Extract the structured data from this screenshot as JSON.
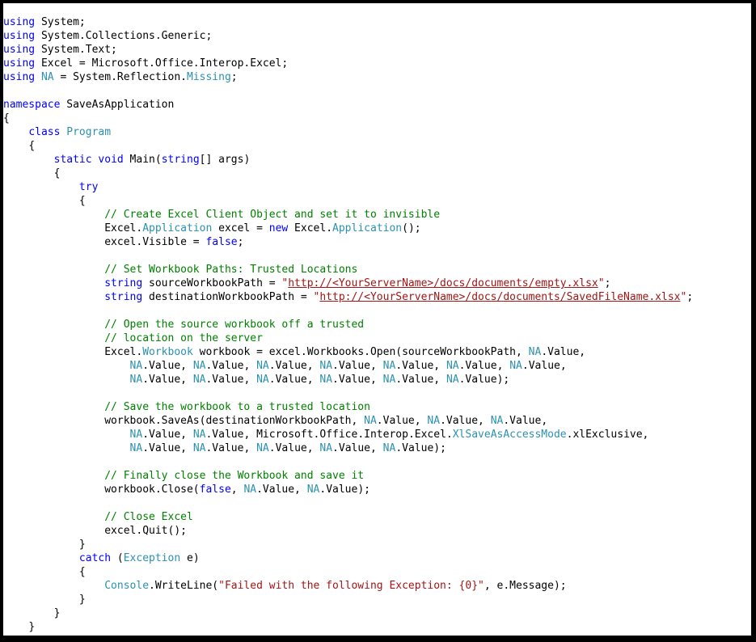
{
  "window": {
    "kind": "code-snippet-image",
    "border_color": "#000000",
    "background_color": "#ffffff",
    "language": "C#"
  },
  "theme": {
    "plain": "#000000",
    "keyword": "#0000ff",
    "type": "#2b91af",
    "comment": "#008000",
    "string": "#a31515",
    "url_string": "#a31515"
  },
  "code": {
    "indent_unit": "    ",
    "lines": [
      {
        "id": "l1",
        "indent": 0,
        "tokens": [
          {
            "t": "using",
            "c": "kw"
          },
          {
            "t": " System;",
            "c": "pl"
          }
        ]
      },
      {
        "id": "l2",
        "indent": 0,
        "tokens": [
          {
            "t": "using",
            "c": "kw"
          },
          {
            "t": " System.Collections.Generic;",
            "c": "pl"
          }
        ]
      },
      {
        "id": "l3",
        "indent": 0,
        "tokens": [
          {
            "t": "using",
            "c": "kw"
          },
          {
            "t": " System.Text;",
            "c": "pl"
          }
        ]
      },
      {
        "id": "l4",
        "indent": 0,
        "tokens": [
          {
            "t": "using",
            "c": "kw"
          },
          {
            "t": " Excel = Microsoft.Office.Interop.Excel;",
            "c": "pl"
          }
        ]
      },
      {
        "id": "l5",
        "indent": 0,
        "tokens": [
          {
            "t": "using",
            "c": "kw"
          },
          {
            "t": " ",
            "c": "pl"
          },
          {
            "t": "NA",
            "c": "ty"
          },
          {
            "t": " = System.Reflection.",
            "c": "pl"
          },
          {
            "t": "Missing",
            "c": "ty"
          },
          {
            "t": ";",
            "c": "pl"
          }
        ]
      },
      {
        "id": "l6",
        "indent": 0,
        "tokens": []
      },
      {
        "id": "l7",
        "indent": 0,
        "tokens": [
          {
            "t": "namespace",
            "c": "kw"
          },
          {
            "t": " SaveAsApplication",
            "c": "pl"
          }
        ]
      },
      {
        "id": "l8",
        "indent": 0,
        "tokens": [
          {
            "t": "{",
            "c": "pl"
          }
        ]
      },
      {
        "id": "l9",
        "indent": 1,
        "tokens": [
          {
            "t": "class",
            "c": "kw"
          },
          {
            "t": " ",
            "c": "pl"
          },
          {
            "t": "Program",
            "c": "ty"
          }
        ]
      },
      {
        "id": "l10",
        "indent": 1,
        "tokens": [
          {
            "t": "{",
            "c": "pl"
          }
        ]
      },
      {
        "id": "l11",
        "indent": 2,
        "tokens": [
          {
            "t": "static",
            "c": "kw"
          },
          {
            "t": " ",
            "c": "pl"
          },
          {
            "t": "void",
            "c": "kw"
          },
          {
            "t": " Main(",
            "c": "pl"
          },
          {
            "t": "string",
            "c": "kw"
          },
          {
            "t": "[] args)",
            "c": "pl"
          }
        ]
      },
      {
        "id": "l12",
        "indent": 2,
        "tokens": [
          {
            "t": "{",
            "c": "pl"
          }
        ]
      },
      {
        "id": "l13",
        "indent": 3,
        "tokens": [
          {
            "t": "try",
            "c": "kw"
          }
        ]
      },
      {
        "id": "l14",
        "indent": 3,
        "tokens": [
          {
            "t": "{",
            "c": "pl"
          }
        ]
      },
      {
        "id": "l15",
        "indent": 4,
        "tokens": [
          {
            "t": "// Create Excel Client Object and set it to invisible",
            "c": "cm"
          }
        ]
      },
      {
        "id": "l16",
        "indent": 4,
        "tokens": [
          {
            "t": "Excel.",
            "c": "pl"
          },
          {
            "t": "Application",
            "c": "ty"
          },
          {
            "t": " excel = ",
            "c": "pl"
          },
          {
            "t": "new",
            "c": "kw"
          },
          {
            "t": " Excel.",
            "c": "pl"
          },
          {
            "t": "Application",
            "c": "ty"
          },
          {
            "t": "();",
            "c": "pl"
          }
        ]
      },
      {
        "id": "l17",
        "indent": 4,
        "tokens": [
          {
            "t": "excel.Visible = ",
            "c": "pl"
          },
          {
            "t": "false",
            "c": "kw"
          },
          {
            "t": ";",
            "c": "pl"
          }
        ]
      },
      {
        "id": "l18",
        "indent": 0,
        "tokens": []
      },
      {
        "id": "l19",
        "indent": 4,
        "tokens": [
          {
            "t": "// Set Workbook Paths: Trusted Locations",
            "c": "cm"
          }
        ]
      },
      {
        "id": "l20",
        "indent": 4,
        "tokens": [
          {
            "t": "string",
            "c": "kw"
          },
          {
            "t": " sourceWorkbookPath = ",
            "c": "pl"
          },
          {
            "t": "\"",
            "c": "st"
          },
          {
            "t": "http://<YourServerName>/docs/documents/empty.xlsx",
            "c": "url"
          },
          {
            "t": "\"",
            "c": "st"
          },
          {
            "t": ";",
            "c": "pl"
          }
        ]
      },
      {
        "id": "l21",
        "indent": 4,
        "tokens": [
          {
            "t": "string",
            "c": "kw"
          },
          {
            "t": " destinationWorkbookPath = ",
            "c": "pl"
          },
          {
            "t": "\"",
            "c": "st"
          },
          {
            "t": "http://<YourServerName>/docs/documents/SavedFileName.xlsx",
            "c": "url"
          },
          {
            "t": "\"",
            "c": "st"
          },
          {
            "t": ";",
            "c": "pl"
          }
        ]
      },
      {
        "id": "l22",
        "indent": 0,
        "tokens": []
      },
      {
        "id": "l23",
        "indent": 4,
        "tokens": [
          {
            "t": "// Open the source workbook off a trusted",
            "c": "cm"
          }
        ]
      },
      {
        "id": "l24",
        "indent": 4,
        "tokens": [
          {
            "t": "// location on the server",
            "c": "cm"
          }
        ]
      },
      {
        "id": "l25",
        "indent": 4,
        "tokens": [
          {
            "t": "Excel.",
            "c": "pl"
          },
          {
            "t": "Workbook",
            "c": "ty"
          },
          {
            "t": " workbook = excel.Workbooks.Open(sourceWorkbookPath, ",
            "c": "pl"
          },
          {
            "t": "NA",
            "c": "ty"
          },
          {
            "t": ".Value,",
            "c": "pl"
          }
        ]
      },
      {
        "id": "l26",
        "indent": 5,
        "tokens": [
          {
            "t": "NA",
            "c": "ty"
          },
          {
            "t": ".Value, ",
            "c": "pl"
          },
          {
            "t": "NA",
            "c": "ty"
          },
          {
            "t": ".Value, ",
            "c": "pl"
          },
          {
            "t": "NA",
            "c": "ty"
          },
          {
            "t": ".Value, ",
            "c": "pl"
          },
          {
            "t": "NA",
            "c": "ty"
          },
          {
            "t": ".Value, ",
            "c": "pl"
          },
          {
            "t": "NA",
            "c": "ty"
          },
          {
            "t": ".Value, ",
            "c": "pl"
          },
          {
            "t": "NA",
            "c": "ty"
          },
          {
            "t": ".Value, ",
            "c": "pl"
          },
          {
            "t": "NA",
            "c": "ty"
          },
          {
            "t": ".Value,",
            "c": "pl"
          }
        ]
      },
      {
        "id": "l27",
        "indent": 5,
        "tokens": [
          {
            "t": "NA",
            "c": "ty"
          },
          {
            "t": ".Value, ",
            "c": "pl"
          },
          {
            "t": "NA",
            "c": "ty"
          },
          {
            "t": ".Value, ",
            "c": "pl"
          },
          {
            "t": "NA",
            "c": "ty"
          },
          {
            "t": ".Value, ",
            "c": "pl"
          },
          {
            "t": "NA",
            "c": "ty"
          },
          {
            "t": ".Value, ",
            "c": "pl"
          },
          {
            "t": "NA",
            "c": "ty"
          },
          {
            "t": ".Value, ",
            "c": "pl"
          },
          {
            "t": "NA",
            "c": "ty"
          },
          {
            "t": ".Value);",
            "c": "pl"
          }
        ]
      },
      {
        "id": "l28",
        "indent": 0,
        "tokens": []
      },
      {
        "id": "l29",
        "indent": 4,
        "tokens": [
          {
            "t": "// Save the workbook to a trusted location",
            "c": "cm"
          }
        ]
      },
      {
        "id": "l30",
        "indent": 4,
        "tokens": [
          {
            "t": "workbook.SaveAs(destinationWorkbookPath, ",
            "c": "pl"
          },
          {
            "t": "NA",
            "c": "ty"
          },
          {
            "t": ".Value, ",
            "c": "pl"
          },
          {
            "t": "NA",
            "c": "ty"
          },
          {
            "t": ".Value, ",
            "c": "pl"
          },
          {
            "t": "NA",
            "c": "ty"
          },
          {
            "t": ".Value,",
            "c": "pl"
          }
        ]
      },
      {
        "id": "l31",
        "indent": 5,
        "tokens": [
          {
            "t": "NA",
            "c": "ty"
          },
          {
            "t": ".Value, ",
            "c": "pl"
          },
          {
            "t": "NA",
            "c": "ty"
          },
          {
            "t": ".Value, Microsoft.Office.Interop.Excel.",
            "c": "pl"
          },
          {
            "t": "XlSaveAsAccessMode",
            "c": "ty"
          },
          {
            "t": ".xlExclusive,",
            "c": "pl"
          }
        ]
      },
      {
        "id": "l32",
        "indent": 5,
        "tokens": [
          {
            "t": "NA",
            "c": "ty"
          },
          {
            "t": ".Value, ",
            "c": "pl"
          },
          {
            "t": "NA",
            "c": "ty"
          },
          {
            "t": ".Value, ",
            "c": "pl"
          },
          {
            "t": "NA",
            "c": "ty"
          },
          {
            "t": ".Value, ",
            "c": "pl"
          },
          {
            "t": "NA",
            "c": "ty"
          },
          {
            "t": ".Value, ",
            "c": "pl"
          },
          {
            "t": "NA",
            "c": "ty"
          },
          {
            "t": ".Value);",
            "c": "pl"
          }
        ]
      },
      {
        "id": "l33",
        "indent": 0,
        "tokens": []
      },
      {
        "id": "l34",
        "indent": 4,
        "tokens": [
          {
            "t": "// Finally close the Workbook and save it",
            "c": "cm"
          }
        ]
      },
      {
        "id": "l35",
        "indent": 4,
        "tokens": [
          {
            "t": "workbook.Close(",
            "c": "pl"
          },
          {
            "t": "false",
            "c": "kw"
          },
          {
            "t": ", ",
            "c": "pl"
          },
          {
            "t": "NA",
            "c": "ty"
          },
          {
            "t": ".Value, ",
            "c": "pl"
          },
          {
            "t": "NA",
            "c": "ty"
          },
          {
            "t": ".Value);",
            "c": "pl"
          }
        ]
      },
      {
        "id": "l36",
        "indent": 0,
        "tokens": []
      },
      {
        "id": "l37",
        "indent": 4,
        "tokens": [
          {
            "t": "// Close Excel",
            "c": "cm"
          }
        ]
      },
      {
        "id": "l38",
        "indent": 4,
        "tokens": [
          {
            "t": "excel.Quit();",
            "c": "pl"
          }
        ]
      },
      {
        "id": "l39",
        "indent": 3,
        "tokens": [
          {
            "t": "}",
            "c": "pl"
          }
        ]
      },
      {
        "id": "l40",
        "indent": 3,
        "tokens": [
          {
            "t": "catch",
            "c": "kw"
          },
          {
            "t": " (",
            "c": "pl"
          },
          {
            "t": "Exception",
            "c": "ty"
          },
          {
            "t": " e)",
            "c": "pl"
          }
        ]
      },
      {
        "id": "l41",
        "indent": 3,
        "tokens": [
          {
            "t": "{",
            "c": "pl"
          }
        ]
      },
      {
        "id": "l42",
        "indent": 4,
        "tokens": [
          {
            "t": "Console",
            "c": "ty"
          },
          {
            "t": ".WriteLine(",
            "c": "pl"
          },
          {
            "t": "\"Failed with the following Exception: {0}\"",
            "c": "st"
          },
          {
            "t": ", e.Message);",
            "c": "pl"
          }
        ]
      },
      {
        "id": "l43",
        "indent": 3,
        "tokens": [
          {
            "t": "}",
            "c": "pl"
          }
        ]
      },
      {
        "id": "l44",
        "indent": 2,
        "tokens": [
          {
            "t": "}",
            "c": "pl"
          }
        ]
      },
      {
        "id": "l45",
        "indent": 1,
        "tokens": [
          {
            "t": "}",
            "c": "pl"
          }
        ]
      },
      {
        "id": "l46",
        "indent": 0,
        "tokens": [
          {
            "t": "}",
            "c": "pl"
          }
        ]
      }
    ]
  }
}
